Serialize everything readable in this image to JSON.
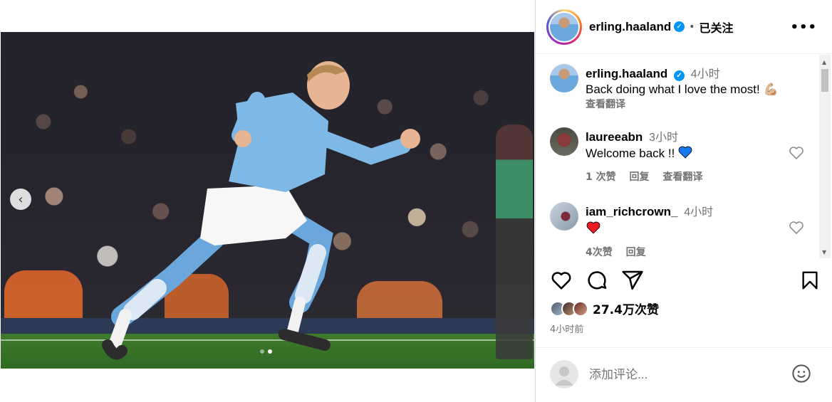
{
  "post": {
    "image_count": 2,
    "active_image_index": 1
  },
  "header": {
    "username": "erling.haaland",
    "follow_status": "已关注",
    "more_icon": "ellipsis-icon"
  },
  "caption": {
    "username": "erling.haaland",
    "time": "4小时",
    "text": "Back doing what I love the most! 💪🏼",
    "translate": "查看翻译"
  },
  "comments": [
    {
      "username": "laureeabn",
      "time": "3小时",
      "text": "Welcome back !!",
      "emoji": "blue-heart",
      "likes": "1 次赞",
      "reply": "回复",
      "translate": "查看翻译"
    },
    {
      "username": "iam_richcrown_",
      "time": "4小时",
      "text": "",
      "emoji": "red-heart",
      "likes": "4次赞",
      "reply": "回复"
    }
  ],
  "actions": {
    "like_icon": "heart-icon",
    "comment_icon": "comment-icon",
    "share_icon": "send-icon",
    "save_icon": "bookmark-icon"
  },
  "likes_summary": "27.4万次赞",
  "posted_ago": "4小时前",
  "add_comment": {
    "placeholder": "添加评论..."
  },
  "colors": {
    "verified": "#0095f6",
    "secondary_text": "#737373",
    "blue_heart": "#1877f2",
    "red_heart": "#ed1c24"
  }
}
